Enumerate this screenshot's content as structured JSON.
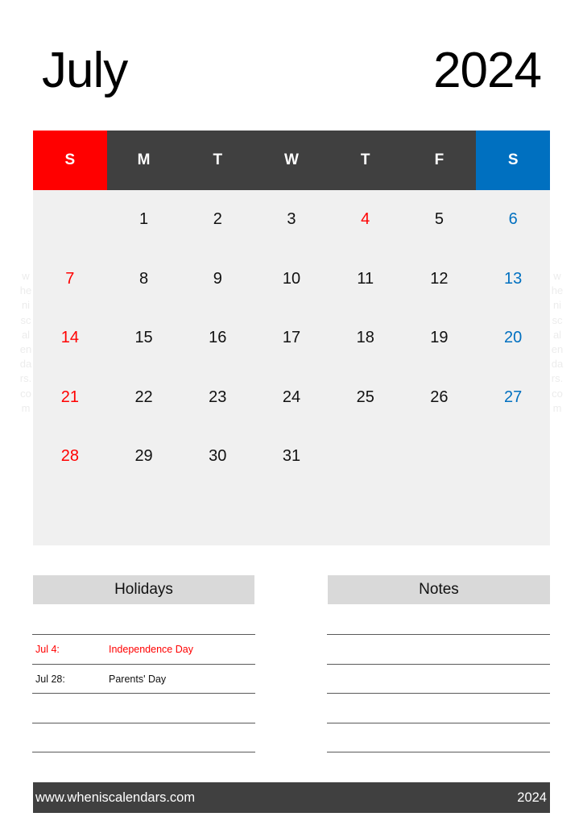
{
  "header": {
    "month": "July",
    "year": "2024"
  },
  "watermark": {
    "text": "wheniscalendars.com"
  },
  "colors": {
    "sunday_header": "#ff0000",
    "weekday_header": "#404040",
    "saturday_header": "#0070c0",
    "sunday_date": "#ff0000",
    "saturday_date": "#0070c0",
    "holiday_date": "#ff0000",
    "grid_background": "#f0f0f0",
    "section_header": "#d9d9d9",
    "footer_background": "#404040"
  },
  "calendar": {
    "weekdays": [
      "S",
      "M",
      "T",
      "W",
      "T",
      "F",
      "S"
    ],
    "weeks": [
      [
        "",
        "1",
        "2",
        "3",
        "4",
        "5",
        "6"
      ],
      [
        "7",
        "8",
        "9",
        "10",
        "11",
        "12",
        "13"
      ],
      [
        "14",
        "15",
        "16",
        "17",
        "18",
        "19",
        "20"
      ],
      [
        "21",
        "22",
        "23",
        "24",
        "25",
        "26",
        "27"
      ],
      [
        "28",
        "29",
        "30",
        "31",
        "",
        "",
        ""
      ],
      [
        "",
        "",
        "",
        "",
        "",
        "",
        ""
      ]
    ],
    "holiday_dates": [
      "4"
    ]
  },
  "holidays": {
    "title": "Holidays",
    "items": [
      {
        "date": "Jul 4:",
        "name": "Independence Day",
        "highlight": true
      },
      {
        "date": "Jul 28:",
        "name": "Parents' Day",
        "highlight": false
      }
    ]
  },
  "notes": {
    "title": "Notes"
  },
  "footer": {
    "website": "www.wheniscalendars.com",
    "year": "2024"
  }
}
